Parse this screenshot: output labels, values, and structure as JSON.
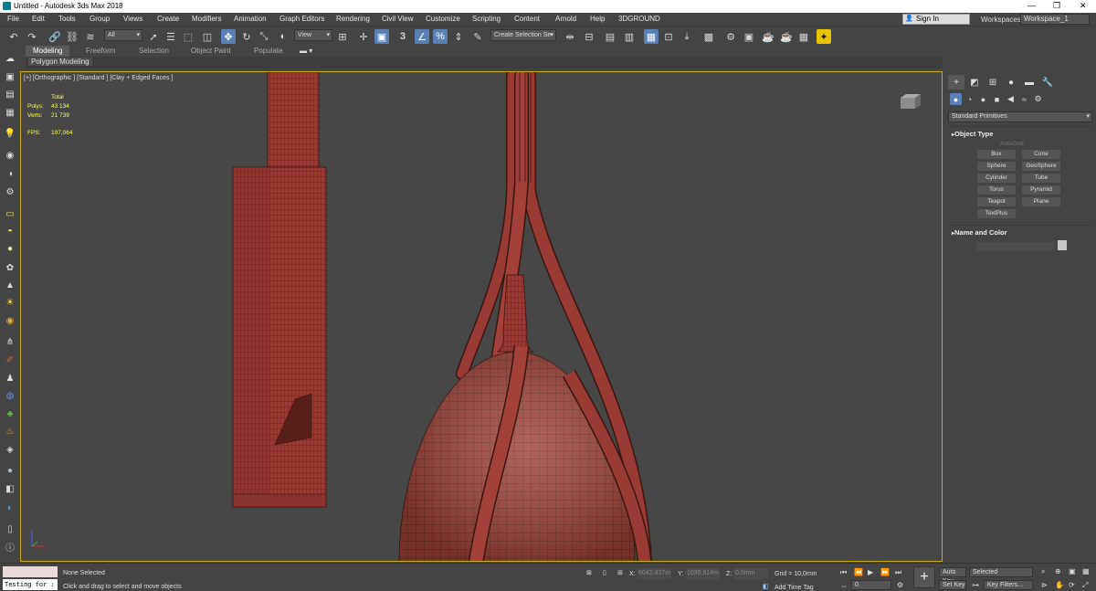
{
  "title": "Untitled - Autodesk 3ds Max 2018",
  "window_controls": {
    "minimize": "—",
    "maximize": "❐",
    "close": "✕"
  },
  "menu": [
    "File",
    "Edit",
    "Tools",
    "Group",
    "Views",
    "Create",
    "Modifiers",
    "Animation",
    "Graph Editors",
    "Rendering",
    "Civil View",
    "Customize",
    "Scripting",
    "Content",
    "Arnold",
    "Help",
    "3DGROUND"
  ],
  "account": {
    "sign_in": "Sign In",
    "workspaces_label": "Workspaces:",
    "workspace": "Workspace_1"
  },
  "toolbar": {
    "selection_filter": "All",
    "ref_coord": "View",
    "named_selection": "Create Selection Se",
    "snap_label": "3",
    "icons": [
      "undo-icon",
      "redo-icon",
      "link-icon",
      "unlink-icon",
      "bind-spacewarp-icon",
      "select-object-icon",
      "select-by-name-icon",
      "rect-region-icon",
      "window-crossing-icon",
      "select-move-icon",
      "select-rotate-icon",
      "select-scale-icon",
      "place-icon",
      "pivot-icon",
      "key-mode-icon",
      "snap-toggle-icon",
      "angle-snap-icon",
      "percent-snap-icon",
      "spinner-snap-icon",
      "edit-named-sel-icon",
      "mirror-icon",
      "align-icon",
      "toggle-scene-explorer-icon",
      "toggle-layer-explorer-icon",
      "toggle-ribbon-icon",
      "curve-editor-icon",
      "schematic-view-icon",
      "material-editor-icon",
      "render-setup-icon",
      "rendered-frame-icon",
      "render-production-icon",
      "render-iterative-icon",
      "arnold-icon"
    ]
  },
  "ribbon": {
    "tabs": [
      "Modeling",
      "Freeform",
      "Selection",
      "Object Paint",
      "Populate"
    ],
    "active": "Modeling",
    "panel": "Polygon Modeling"
  },
  "viewport": {
    "label": "[+] [Orthographic ] [Standard ] [Clay + Edged Faces ]",
    "stats": {
      "total_label": "Total",
      "polys_label": "Polys:",
      "polys": "43 134",
      "verts_label": "Verts:",
      "verts": "21 739",
      "fps_label": "FPS:",
      "fps": "197,064"
    },
    "mesh_color": "#9a3a35",
    "wire_color": "#3a1512"
  },
  "command_panel": {
    "dropdown": "Standard Primitives",
    "object_type": {
      "title": "Object Type",
      "autogrid": "AutoGrid",
      "buttons": [
        "Box",
        "Cone",
        "Sphere",
        "GeoSphere",
        "Cylinder",
        "Tube",
        "Torus",
        "Pyramid",
        "Teapot",
        "Plane",
        "TextPlus"
      ]
    },
    "name_color": {
      "title": "Name and Color"
    }
  },
  "status": {
    "maxscript": "Testing for :",
    "selection": "None Selected",
    "prompt": "Click and drag to select and move objects",
    "x_label": "X:",
    "x": "6042,437m",
    "y_label": "Y:",
    "y": "1035,814m",
    "z_label": "Z:",
    "z": "0,0mm",
    "grid": "Grid = 10,0mm",
    "add_time_tag": "Add Time Tag",
    "frame": "0",
    "auto_key": "Auto Key",
    "set_key": "Set Key",
    "key_filter": "Selected",
    "key_filters_btn": "Key Filters..."
  }
}
